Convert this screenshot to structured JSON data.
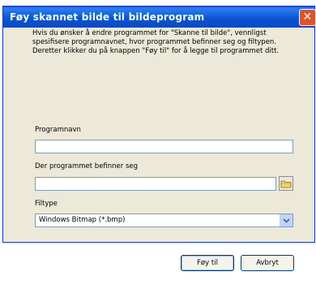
{
  "window": {
    "title": "Føy skannet bilde til bildeprogram",
    "close_symbol": "✕"
  },
  "description": {
    "para1": "Hvis du ønsker å endre programmet for \"Skanne til bilde\", vennligst spesifisere programnavnet, hvor programmet befinner seg og filtypen.",
    "para2": "Deretter klikker du på knappen \"Føy til\" for å legge til programmet ditt."
  },
  "form": {
    "program_name_label": "Programnavn",
    "program_name_value": "",
    "location_label": "Der programmet befinner seg",
    "location_value": "",
    "filetype_label": "Filtype",
    "filetype_value": "Windows Bitmap (*.bmp)"
  },
  "buttons": {
    "add_label": "Føy til",
    "cancel_label": "Avbryt"
  },
  "icons": {
    "browse": "folder-icon",
    "dropdown": "chevron-down-icon",
    "close": "close-icon"
  },
  "colors": {
    "titlebar": "#0a55d4",
    "close": "#e2522a",
    "dialog_bg": "#ece9d8"
  }
}
